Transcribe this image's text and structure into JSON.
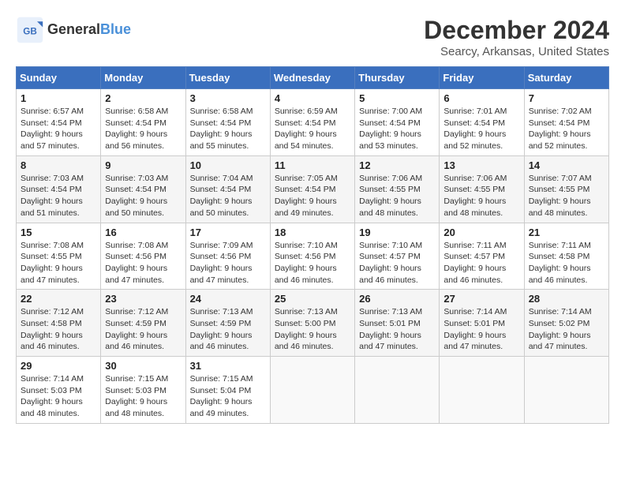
{
  "logo": {
    "text_general": "General",
    "text_blue": "Blue"
  },
  "title": "December 2024",
  "subtitle": "Searcy, Arkansas, United States",
  "days_of_week": [
    "Sunday",
    "Monday",
    "Tuesday",
    "Wednesday",
    "Thursday",
    "Friday",
    "Saturday"
  ],
  "weeks": [
    [
      {
        "day": "1",
        "sunrise": "6:57 AM",
        "sunset": "4:54 PM",
        "daylight": "9 hours and 57 minutes."
      },
      {
        "day": "2",
        "sunrise": "6:58 AM",
        "sunset": "4:54 PM",
        "daylight": "9 hours and 56 minutes."
      },
      {
        "day": "3",
        "sunrise": "6:58 AM",
        "sunset": "4:54 PM",
        "daylight": "9 hours and 55 minutes."
      },
      {
        "day": "4",
        "sunrise": "6:59 AM",
        "sunset": "4:54 PM",
        "daylight": "9 hours and 54 minutes."
      },
      {
        "day": "5",
        "sunrise": "7:00 AM",
        "sunset": "4:54 PM",
        "daylight": "9 hours and 53 minutes."
      },
      {
        "day": "6",
        "sunrise": "7:01 AM",
        "sunset": "4:54 PM",
        "daylight": "9 hours and 52 minutes."
      },
      {
        "day": "7",
        "sunrise": "7:02 AM",
        "sunset": "4:54 PM",
        "daylight": "9 hours and 52 minutes."
      }
    ],
    [
      {
        "day": "8",
        "sunrise": "7:03 AM",
        "sunset": "4:54 PM",
        "daylight": "9 hours and 51 minutes."
      },
      {
        "day": "9",
        "sunrise": "7:03 AM",
        "sunset": "4:54 PM",
        "daylight": "9 hours and 50 minutes."
      },
      {
        "day": "10",
        "sunrise": "7:04 AM",
        "sunset": "4:54 PM",
        "daylight": "9 hours and 50 minutes."
      },
      {
        "day": "11",
        "sunrise": "7:05 AM",
        "sunset": "4:54 PM",
        "daylight": "9 hours and 49 minutes."
      },
      {
        "day": "12",
        "sunrise": "7:06 AM",
        "sunset": "4:55 PM",
        "daylight": "9 hours and 48 minutes."
      },
      {
        "day": "13",
        "sunrise": "7:06 AM",
        "sunset": "4:55 PM",
        "daylight": "9 hours and 48 minutes."
      },
      {
        "day": "14",
        "sunrise": "7:07 AM",
        "sunset": "4:55 PM",
        "daylight": "9 hours and 48 minutes."
      }
    ],
    [
      {
        "day": "15",
        "sunrise": "7:08 AM",
        "sunset": "4:55 PM",
        "daylight": "9 hours and 47 minutes."
      },
      {
        "day": "16",
        "sunrise": "7:08 AM",
        "sunset": "4:56 PM",
        "daylight": "9 hours and 47 minutes."
      },
      {
        "day": "17",
        "sunrise": "7:09 AM",
        "sunset": "4:56 PM",
        "daylight": "9 hours and 47 minutes."
      },
      {
        "day": "18",
        "sunrise": "7:10 AM",
        "sunset": "4:56 PM",
        "daylight": "9 hours and 46 minutes."
      },
      {
        "day": "19",
        "sunrise": "7:10 AM",
        "sunset": "4:57 PM",
        "daylight": "9 hours and 46 minutes."
      },
      {
        "day": "20",
        "sunrise": "7:11 AM",
        "sunset": "4:57 PM",
        "daylight": "9 hours and 46 minutes."
      },
      {
        "day": "21",
        "sunrise": "7:11 AM",
        "sunset": "4:58 PM",
        "daylight": "9 hours and 46 minutes."
      }
    ],
    [
      {
        "day": "22",
        "sunrise": "7:12 AM",
        "sunset": "4:58 PM",
        "daylight": "9 hours and 46 minutes."
      },
      {
        "day": "23",
        "sunrise": "7:12 AM",
        "sunset": "4:59 PM",
        "daylight": "9 hours and 46 minutes."
      },
      {
        "day": "24",
        "sunrise": "7:13 AM",
        "sunset": "4:59 PM",
        "daylight": "9 hours and 46 minutes."
      },
      {
        "day": "25",
        "sunrise": "7:13 AM",
        "sunset": "5:00 PM",
        "daylight": "9 hours and 46 minutes."
      },
      {
        "day": "26",
        "sunrise": "7:13 AM",
        "sunset": "5:01 PM",
        "daylight": "9 hours and 47 minutes."
      },
      {
        "day": "27",
        "sunrise": "7:14 AM",
        "sunset": "5:01 PM",
        "daylight": "9 hours and 47 minutes."
      },
      {
        "day": "28",
        "sunrise": "7:14 AM",
        "sunset": "5:02 PM",
        "daylight": "9 hours and 47 minutes."
      }
    ],
    [
      {
        "day": "29",
        "sunrise": "7:14 AM",
        "sunset": "5:03 PM",
        "daylight": "9 hours and 48 minutes."
      },
      {
        "day": "30",
        "sunrise": "7:15 AM",
        "sunset": "5:03 PM",
        "daylight": "9 hours and 48 minutes."
      },
      {
        "day": "31",
        "sunrise": "7:15 AM",
        "sunset": "5:04 PM",
        "daylight": "9 hours and 49 minutes."
      },
      null,
      null,
      null,
      null
    ]
  ]
}
